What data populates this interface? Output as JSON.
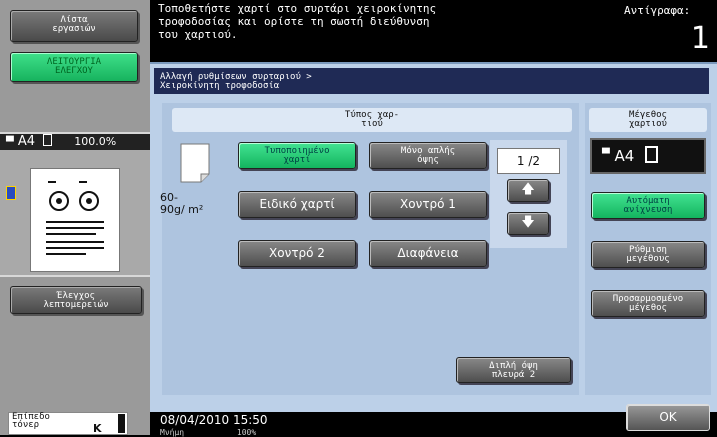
{
  "left_panel": {
    "job_list_label": "Λίστα\nεργασιών",
    "function_check_label": "ΛΕΙΤΟΥΡΓΙΑ\nΕΛΕΓΧΟΥ",
    "thumb_paper_size": "A4",
    "thumb_zoom": "100.0%",
    "detail_check_label": "Έλεγχος\nλεπτομερειών",
    "toner_label": "Επίπεδο\nτόνερ",
    "toner_color": "K"
  },
  "header": {
    "message": "Τοποθετήστε χαρτί στο συρτάρι χειροκίνητης\nτροφοδοσίας και ορίστε τη σωστή διεύθυνση\nτου χαρτιού.",
    "copies_label": "Αντίγραφα:",
    "copies_value": "1"
  },
  "breadcrumb": "Αλλαγή ρυθμίσεων συρταριού >\nΧειροκίνητη τροφοδοσία",
  "paper_type": {
    "header": "Τύπος χαρ-\nτιού",
    "paper_weight": "60-\n90g/ m²",
    "buttons": [
      {
        "label": "Τυποποιημένο\nχαρτί",
        "selected": true
      },
      {
        "label": "Μόνο απλής\nόψης",
        "selected": false
      },
      {
        "label": "Ειδικό χαρτί",
        "selected": false
      },
      {
        "label": "Χοντρό 1",
        "selected": false
      },
      {
        "label": "Χοντρό 2",
        "selected": false
      },
      {
        "label": "Διαφάνεια",
        "selected": false
      }
    ],
    "page_indicator": "1 /2",
    "duplex_label": "Διπλή όψη\nπλευρά 2"
  },
  "paper_size": {
    "header": "Μέγεθος\nχαρτιού",
    "current": "A4",
    "auto_detect_label": "Αυτόματη\nανίχνευση",
    "size_setting_label": "Ρύθμιση\nμεγέθους",
    "custom_size_label": "Προσαρμοσμένο\nμέγεθος"
  },
  "footer": {
    "datetime": "08/04/2010   15:50",
    "memory_label": "Μνήμη",
    "memory_value": "100%",
    "ok_label": "OK"
  },
  "colors": {
    "selected_green": "#22c46e",
    "panel_blue": "#bcd0e8",
    "breadcrumb_navy": "#1f2a55"
  }
}
